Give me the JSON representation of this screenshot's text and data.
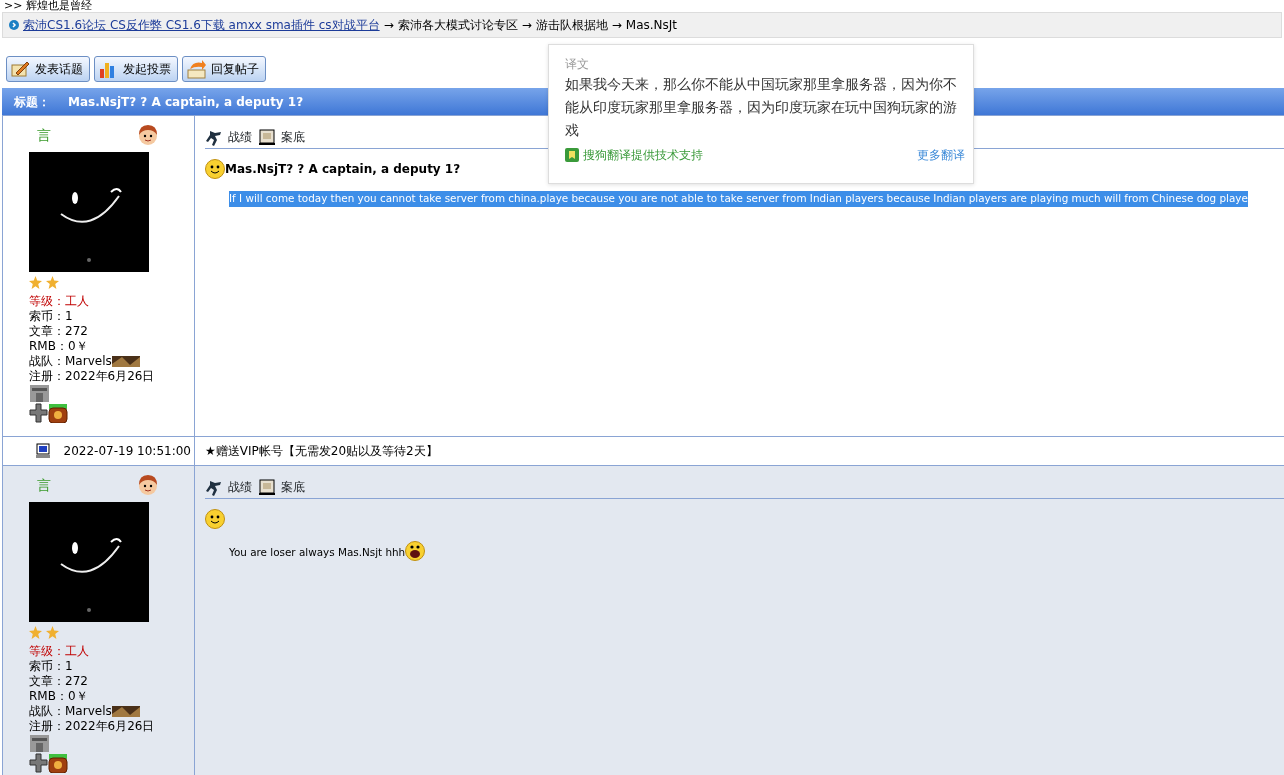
{
  "header_note": ">> 辉煌也是曾经",
  "breadcrumb": [
    {
      "kind": "link",
      "text": "索沛CS1.6论坛 CS反作弊 CS1.6下载 amxx sma插件 cs对战平台"
    },
    {
      "kind": "arrow",
      "text": "→"
    },
    {
      "kind": "text",
      "text": "索沛各大模式讨论专区"
    },
    {
      "kind": "arrow",
      "text": "→"
    },
    {
      "kind": "text",
      "text": "游击队根据地"
    },
    {
      "kind": "arrow",
      "text": "→"
    },
    {
      "kind": "text",
      "text": "Mas.NsJt"
    }
  ],
  "toolbar": [
    {
      "kind": "post",
      "label": "发表话题"
    },
    {
      "kind": "vote",
      "label": "发起投票"
    },
    {
      "kind": "reply",
      "label": "回复帖子"
    }
  ],
  "thread_title": {
    "label": "标题：",
    "title": "Mas.NsjT? ? A captain, a deputy 1?"
  },
  "posts": [
    {
      "shaded": false,
      "user": {
        "name": "言",
        "rank_icons": [
          {
            "kind": "star"
          },
          {
            "kind": "star"
          }
        ],
        "rank_label": "等级：",
        "rank": "工人",
        "stats": [
          {
            "label": "索币：",
            "value": "1"
          },
          {
            "label": "文章：",
            "value": "272"
          },
          {
            "label": "RMB：",
            "value": "0￥"
          },
          {
            "label": "战队：",
            "value": "Marvels",
            "team_image": true
          },
          {
            "label": "注册：",
            "value": "2022年6月26日"
          }
        ]
      },
      "actions": [
        {
          "kind": "record",
          "label": "战绩"
        },
        {
          "kind": "file",
          "label": "案底"
        }
      ],
      "title": "Mas.NsjT? ? A captain, a deputy 1?",
      "body": "If I will come today then you cannot take server from china.playe because you are not able to take server from Indian players because Indian players are playing much will from Chinese dog playe",
      "body_selected": true,
      "body_emoji": false,
      "footer": {
        "time": "2022-07-19 10:51:00",
        "signature": "★赠送VIP帐号【无需发20贴以及等待2天】"
      }
    },
    {
      "shaded": true,
      "user": {
        "name": "言",
        "rank_icons": [
          {
            "kind": "star"
          },
          {
            "kind": "star"
          }
        ],
        "rank_label": "等级：",
        "rank": "工人",
        "stats": [
          {
            "label": "索币：",
            "value": "1"
          },
          {
            "label": "文章：",
            "value": "272"
          },
          {
            "label": "RMB：",
            "value": "0￥"
          },
          {
            "label": "战队：",
            "value": "Marvels",
            "team_image": true
          },
          {
            "label": "注册：",
            "value": "2022年6月26日"
          }
        ]
      },
      "actions": [
        {
          "kind": "record",
          "label": "战绩"
        },
        {
          "kind": "file",
          "label": "案底"
        }
      ],
      "body": "You are loser always Mas.Nsjt hhh",
      "body_selected": false,
      "body_emoji": true
    }
  ],
  "translation_popup": {
    "heading": "译文",
    "text": "如果我今天来，那么你不能从中国玩家那里拿服务器，因为你不能从印度玩家那里拿服务器，因为印度玩家在玩中国狗玩家的游戏",
    "credit": "搜狗翻译提供技术支持",
    "more": "更多翻译"
  }
}
